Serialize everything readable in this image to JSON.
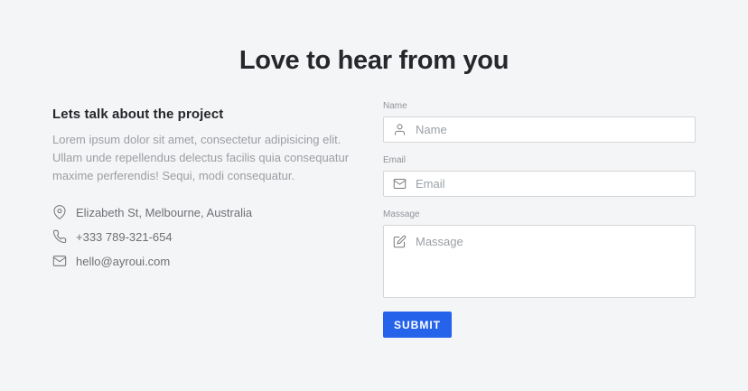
{
  "page": {
    "title": "Love to hear from you"
  },
  "info": {
    "heading": "Lets talk about the project",
    "description": "Lorem ipsum dolor sit amet, consectetur adipisicing elit. Ullam unde repellendus delectus facilis quia consequatur maxime perferendis! Sequi, modi consequatur.",
    "contacts": [
      {
        "icon": "location-pin-icon",
        "text": "Elizabeth St, Melbourne, Australia"
      },
      {
        "icon": "phone-icon",
        "text": "+333 789-321-654"
      },
      {
        "icon": "envelope-icon",
        "text": "hello@ayroui.com"
      }
    ]
  },
  "form": {
    "fields": [
      {
        "label": "Name",
        "placeholder": "Name",
        "icon": "user-icon"
      },
      {
        "label": "Email",
        "placeholder": "Email",
        "icon": "envelope-icon"
      },
      {
        "label": "Massage",
        "placeholder": "Massage",
        "icon": "edit-icon"
      }
    ],
    "submit_label": "SUBMIT"
  },
  "colors": {
    "accent": "#2563eb",
    "background": "#f4f5f6",
    "heading_text": "#25272b",
    "muted_text": "#9b9ea3",
    "contact_text": "#6e7175",
    "border": "#d5d6d8"
  }
}
